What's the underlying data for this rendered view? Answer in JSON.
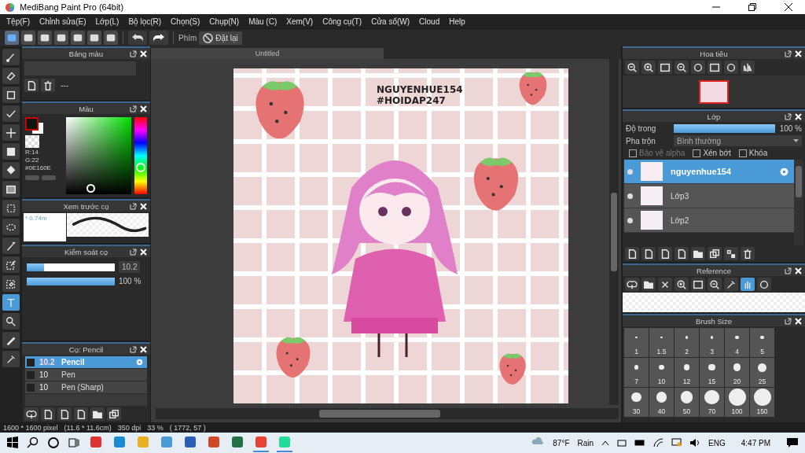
{
  "window": {
    "title": "MediBang Paint Pro (64bit)"
  },
  "menu": [
    "Tệp(F)",
    "Chỉnh sửa(E)",
    "Lớp(L)",
    "Bộ lọc(R)",
    "Chọn(S)",
    "Chụp(N)",
    "Màu (C)",
    "Xem(V)",
    "Công cụ(T)",
    "Cửa sổ(W)",
    "Cloud",
    "Help"
  ],
  "toolbar": {
    "shortcut_label": "Phím",
    "reset_button": "Đặt lại"
  },
  "tools": [
    {
      "kind": "brush",
      "selected": false
    },
    {
      "kind": "eraser",
      "selected": false
    },
    {
      "kind": "rect",
      "selected": false
    },
    {
      "kind": "line",
      "selected": false
    },
    {
      "kind": "move",
      "selected": false
    },
    {
      "kind": "fill",
      "selected": false
    },
    {
      "kind": "bucket",
      "selected": false
    },
    {
      "kind": "gradient",
      "selected": false
    },
    {
      "kind": "select",
      "selected": false
    },
    {
      "kind": "lasso",
      "selected": false
    },
    {
      "kind": "wand",
      "selected": false
    },
    {
      "kind": "selpen",
      "selected": false
    },
    {
      "kind": "selerase",
      "selected": false
    },
    {
      "kind": "text",
      "selected": true
    },
    {
      "kind": "operate",
      "selected": false
    },
    {
      "kind": "pen",
      "selected": false
    },
    {
      "kind": "dropper",
      "selected": false
    }
  ],
  "color_palette": {
    "title": "Bảng màu",
    "name": "---"
  },
  "color": {
    "title": "Màu",
    "readout": [
      "R:14",
      "G:22",
      "#0E160E"
    ],
    "hue_slider": {
      "level": 0.35
    }
  },
  "brush_preview": {
    "title": "Xem trước cọ",
    "size": "* 0.74m"
  },
  "brush_control": {
    "title": "Kiểm soát cọ",
    "size": {
      "level": 0.2,
      "reading": "10.2"
    },
    "opacity": {
      "level": 1,
      "reading": "100 %"
    }
  },
  "brush_list": {
    "title": "Cọ: Pencil",
    "items": [
      {
        "size": "10.2",
        "name": "Pencil",
        "selected": true
      },
      {
        "size": "10",
        "name": "Pen",
        "selected": false
      },
      {
        "size": "10",
        "name": "Pen (Sharp)",
        "selected": false
      }
    ]
  },
  "document": {
    "tab": "Untitled",
    "caption": [
      "NGUYENHUE154",
      "#HOIDAP247"
    ]
  },
  "status_bar": [
    "1600 * 1600 pixel",
    "(11.6 * 11.6cm)",
    "350 dpi",
    "33 %",
    "( 1772, 57 )"
  ],
  "navigator": {
    "title": "Hoa tiêu"
  },
  "layers": {
    "title": "Lớp",
    "opacity": {
      "label": "Độ trong",
      "level": 1,
      "reading": "100 %"
    },
    "blend": {
      "label": "Pha trộn",
      "value": "Bình thường"
    },
    "options": [
      {
        "label": "Bảo vệ alpha",
        "checked": false,
        "disabled": true
      },
      {
        "label": "Xén bớt",
        "checked": false,
        "disabled": false
      },
      {
        "label": "Khóa",
        "checked": false,
        "disabled": false
      }
    ],
    "items": [
      {
        "name": "nguyenhue154",
        "selected": true
      },
      {
        "name": "Lớp3",
        "selected": false
      },
      {
        "name": "Lớp2",
        "selected": false
      }
    ]
  },
  "reference": {
    "title": "Reference"
  },
  "brush_size": {
    "title": "Brush Size",
    "sizes": [
      "1",
      "1.5",
      "2",
      "3",
      "4",
      "5",
      "7",
      "10",
      "12",
      "15",
      "20",
      "25",
      "30",
      "40",
      "50",
      "70",
      "100",
      "150"
    ]
  },
  "taskbar": {
    "temperature": "87°F",
    "weather": "Rain",
    "language": "ENG",
    "time": "4:47 PM"
  }
}
